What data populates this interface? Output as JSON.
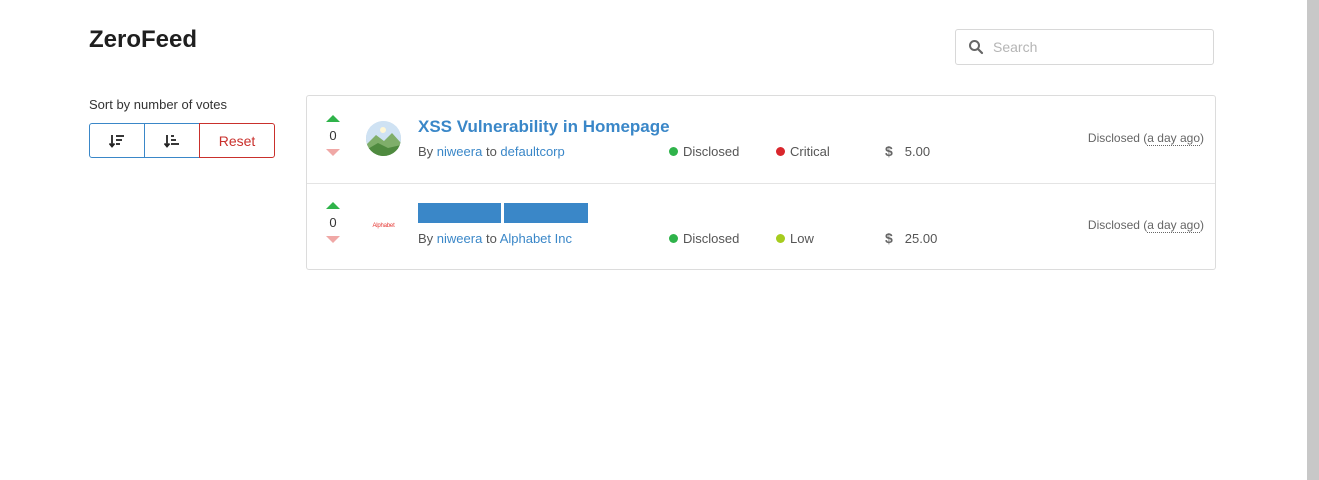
{
  "app": {
    "title": "ZeroFeed"
  },
  "search": {
    "placeholder": "Search",
    "value": ""
  },
  "sort": {
    "label": "Sort by number of votes",
    "reset_label": "Reset"
  },
  "colors": {
    "accent": "#3a87c8",
    "reset": "#c9302c",
    "upvote": "#2fb34a",
    "downvote": "#f0a8a6",
    "status_disclosed": "#2fb34a",
    "severity_critical": "#d9262c",
    "severity_low": "#a6cc1e"
  },
  "reports": [
    {
      "votes": "0",
      "avatar": "landscape-avatar",
      "title": "XSS Vulnerability in Homepage",
      "title_redacted": false,
      "by_prefix": "By",
      "author": "niweera",
      "to_word": "to",
      "program": "defaultcorp",
      "status": "Disclosed",
      "severity": "Critical",
      "bounty": "5.00",
      "disclosed_prefix": "Disclosed (",
      "disclosed_ago": "a day ago",
      "disclosed_suffix": ")"
    },
    {
      "votes": "0",
      "avatar": "alphabet-logo",
      "avatar_text": "Alphabet",
      "title": "",
      "title_redacted": true,
      "by_prefix": "By",
      "author": "niweera",
      "to_word": "to",
      "program": "Alphabet Inc",
      "status": "Disclosed",
      "severity": "Low",
      "bounty": "25.00",
      "disclosed_prefix": "Disclosed (",
      "disclosed_ago": "a day ago",
      "disclosed_suffix": ")"
    }
  ]
}
